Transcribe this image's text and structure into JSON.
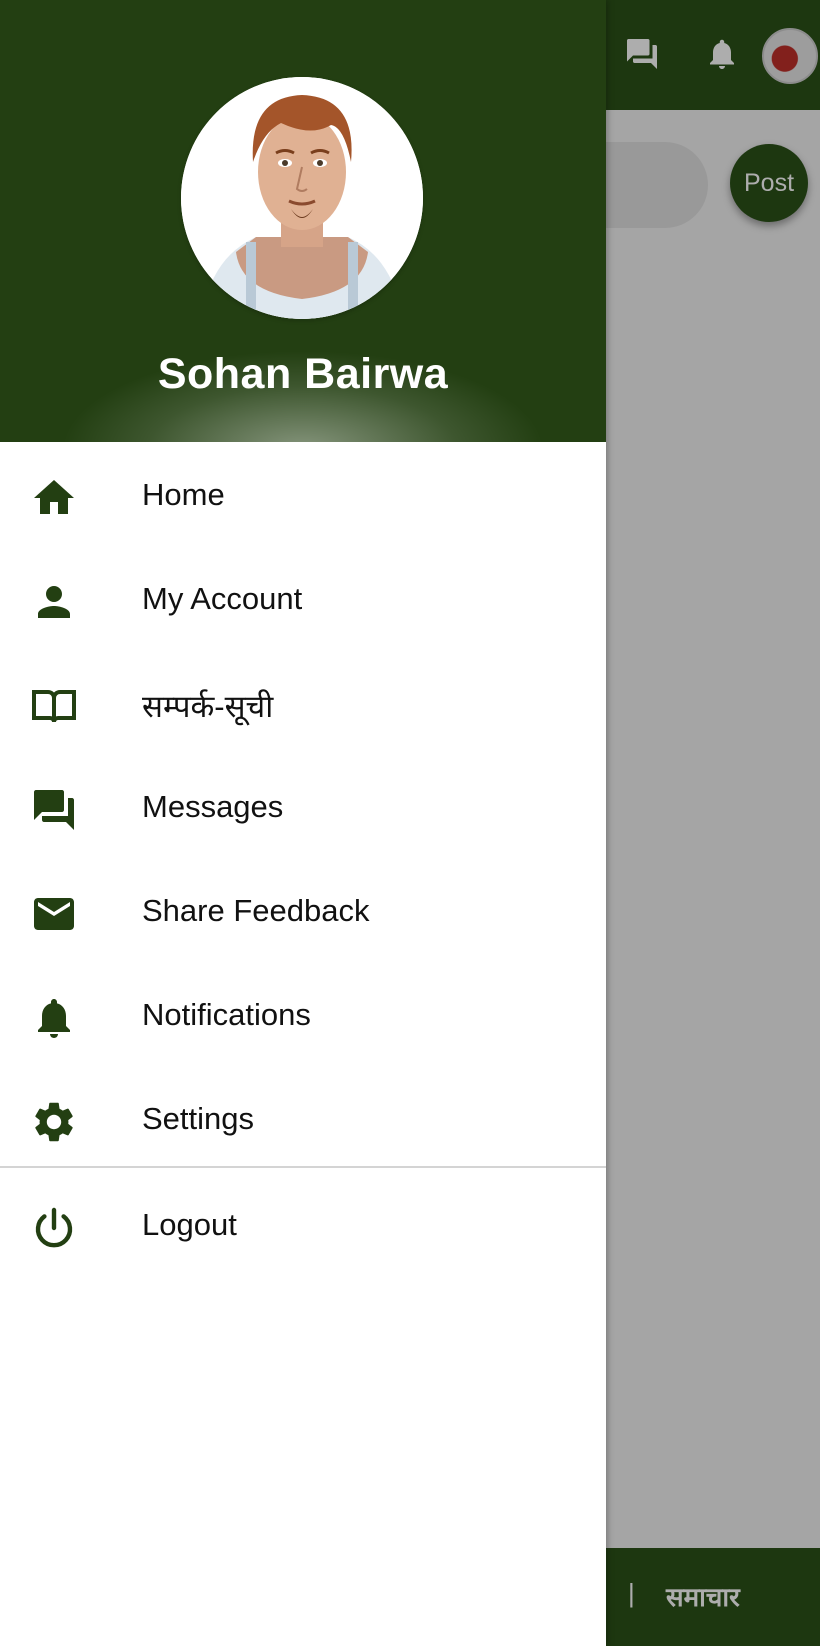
{
  "background_app": {
    "post_button_label": "Post",
    "bottom_nav_separator": "|",
    "bottom_nav_label": "समाचार",
    "top_icons": [
      "messages-icon",
      "bell-icon",
      "avatar"
    ],
    "theme_color": "#2b5219"
  },
  "drawer": {
    "profile_name": "Sohan Bairwa",
    "header_color": "#233f12",
    "icon_color": "#233f12",
    "items": [
      {
        "label": "Home",
        "icon": "home-icon"
      },
      {
        "label": "My Account",
        "icon": "person-icon"
      },
      {
        "label": "सम्पर्क-सूची",
        "icon": "book-icon"
      },
      {
        "label": "Messages",
        "icon": "forum-icon"
      },
      {
        "label": "Share Feedback",
        "icon": "mail-icon"
      },
      {
        "label": "Notifications",
        "icon": "bell-icon"
      },
      {
        "label": "Settings",
        "icon": "gear-icon"
      }
    ],
    "logout": {
      "label": "Logout",
      "icon": "power-icon"
    }
  }
}
